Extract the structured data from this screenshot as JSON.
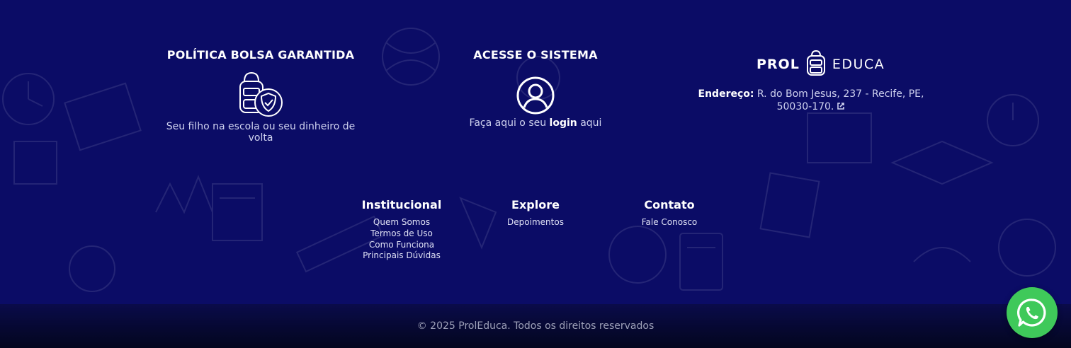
{
  "features": {
    "bolsa": {
      "title": "POLÍTICA BOLSA GARANTIDA",
      "text": "Seu filho na escola ou seu dinheiro de volta",
      "icon": "backpack-shield-icon"
    },
    "sistema": {
      "title": "ACESSE O SISTEMA",
      "text_before": "Faça aqui o seu ",
      "text_bold": "login",
      "text_after": " aqui",
      "icon": "user-circle-icon"
    }
  },
  "brand": {
    "left": "PROL",
    "right": "EDUCA",
    "icon": "backpack-icon"
  },
  "address": {
    "label": "Endereço:",
    "value": " R. do Bom Jesus, 237 - Recife, PE, 50030-170.",
    "icon": "external-link-icon"
  },
  "nav": {
    "institucional": {
      "title": "Institucional",
      "links": [
        "Quem Somos",
        "Termos de Uso",
        "Como Funciona",
        "Principais Dúvidas"
      ]
    },
    "explore": {
      "title": "Explore",
      "links": [
        "Depoimentos"
      ]
    },
    "contato": {
      "title": "Contato",
      "links": [
        "Fale Conosco"
      ]
    }
  },
  "footer": {
    "copyright": "© 2025 ProlEduca. Todos os direitos reservados"
  },
  "whatsapp": {
    "icon": "whatsapp-icon"
  },
  "colors": {
    "background": "#0b0c66",
    "bottom_bar": "#04071f",
    "whatsapp": "#3fc95a"
  }
}
